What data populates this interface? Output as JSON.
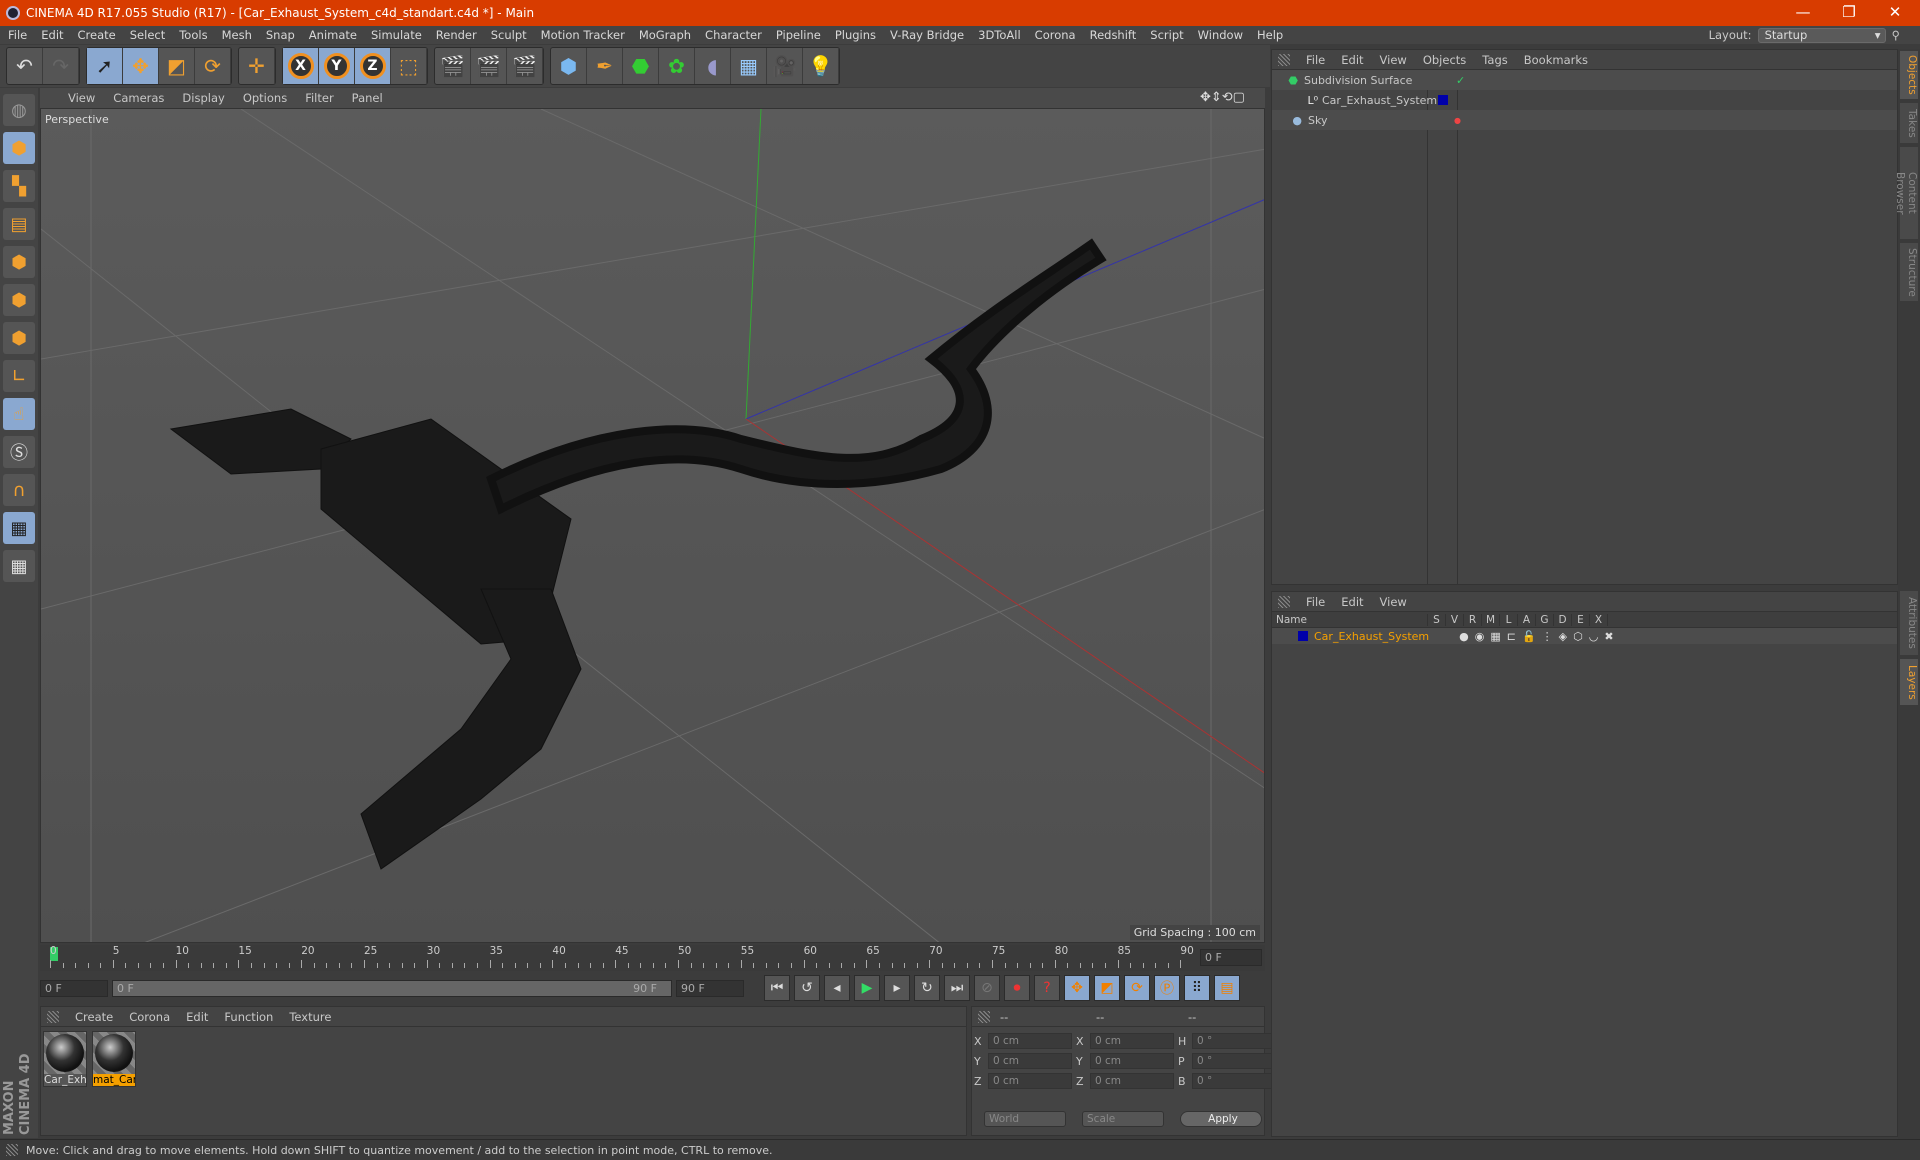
{
  "window": {
    "title": "CINEMA 4D R17.055 Studio (R17) - [Car_Exhaust_System_c4d_standart.c4d *] - Main",
    "minimize": "—",
    "maximize": "❐",
    "close": "✕"
  },
  "menu": [
    "File",
    "Edit",
    "Create",
    "Select",
    "Tools",
    "Mesh",
    "Snap",
    "Animate",
    "Simulate",
    "Render",
    "Sculpt",
    "Motion Tracker",
    "MoGraph",
    "Character",
    "Pipeline",
    "Plugins",
    "V-Ray Bridge",
    "3DToAll",
    "Corona",
    "Redshift",
    "Script",
    "Window",
    "Help"
  ],
  "layout": {
    "label": "Layout:",
    "value": "Startup"
  },
  "viewport": {
    "menu": [
      "View",
      "Cameras",
      "Display",
      "Options",
      "Filter",
      "Panel"
    ],
    "camera": "Perspective",
    "grid_spacing": "Grid Spacing : 100 cm"
  },
  "timeline": {
    "ticks": [
      "0",
      "5",
      "10",
      "15",
      "20",
      "25",
      "30",
      "35",
      "40",
      "45",
      "50",
      "55",
      "60",
      "65",
      "70",
      "75",
      "80",
      "85",
      "90"
    ],
    "current_frame": "0 F",
    "start": "0 F",
    "range_start": "0 F",
    "range_end": "90 F",
    "end": "90 F"
  },
  "materials": {
    "menu": [
      "Create",
      "Corona",
      "Edit",
      "Function",
      "Texture"
    ],
    "items": [
      {
        "name": "Car_Exh",
        "selected": false
      },
      {
        "name": "mat_Car",
        "selected": true
      }
    ]
  },
  "coords": {
    "headers": [
      "--",
      "--",
      "--"
    ],
    "rows": [
      {
        "a": "X",
        "av": "0 cm",
        "b": "X",
        "bv": "0 cm",
        "c": "H",
        "cv": "0 °"
      },
      {
        "a": "Y",
        "av": "0 cm",
        "b": "Y",
        "bv": "0 cm",
        "c": "P",
        "cv": "0 °"
      },
      {
        "a": "Z",
        "av": "0 cm",
        "b": "Z",
        "bv": "0 cm",
        "c": "B",
        "cv": "0 °"
      }
    ],
    "space": "World",
    "mode": "Scale",
    "apply": "Apply"
  },
  "objects": {
    "menu": [
      "File",
      "Edit",
      "View",
      "Objects",
      "Tags",
      "Bookmarks"
    ],
    "items": [
      "Subdivision Surface",
      "Car_Exhaust_System",
      "Sky"
    ]
  },
  "layers": {
    "menu": [
      "File",
      "Edit",
      "View"
    ],
    "columns": [
      "Name",
      "S",
      "V",
      "R",
      "M",
      "L",
      "A",
      "G",
      "D",
      "E",
      "X"
    ],
    "items": [
      {
        "name": "Car_Exhaust_System",
        "color": "#0000aa"
      }
    ]
  },
  "right_tabs": [
    "Objects",
    "Takes",
    "Content Browser",
    "Structure",
    "Attributes",
    "Layers"
  ],
  "status": "Move: Click and drag to move elements. Hold down SHIFT to quantize movement / add to the selection in point mode, CTRL to remove.",
  "brand": "MAXON CINEMA 4D",
  "colors": {
    "titlebar": "#d83c00",
    "accent": "#f5a000",
    "selection_blue": "#8aa8d0"
  }
}
